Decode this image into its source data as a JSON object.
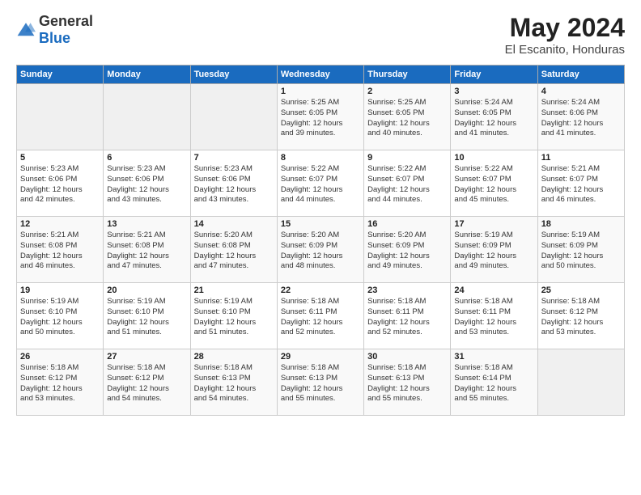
{
  "header": {
    "logo_general": "General",
    "logo_blue": "Blue",
    "month_year": "May 2024",
    "location": "El Escanito, Honduras"
  },
  "days_of_week": [
    "Sunday",
    "Monday",
    "Tuesday",
    "Wednesday",
    "Thursday",
    "Friday",
    "Saturday"
  ],
  "weeks": [
    [
      {
        "day": "",
        "info": ""
      },
      {
        "day": "",
        "info": ""
      },
      {
        "day": "",
        "info": ""
      },
      {
        "day": "1",
        "info": "Sunrise: 5:25 AM\nSunset: 6:05 PM\nDaylight: 12 hours\nand 39 minutes."
      },
      {
        "day": "2",
        "info": "Sunrise: 5:25 AM\nSunset: 6:05 PM\nDaylight: 12 hours\nand 40 minutes."
      },
      {
        "day": "3",
        "info": "Sunrise: 5:24 AM\nSunset: 6:05 PM\nDaylight: 12 hours\nand 41 minutes."
      },
      {
        "day": "4",
        "info": "Sunrise: 5:24 AM\nSunset: 6:06 PM\nDaylight: 12 hours\nand 41 minutes."
      }
    ],
    [
      {
        "day": "5",
        "info": "Sunrise: 5:23 AM\nSunset: 6:06 PM\nDaylight: 12 hours\nand 42 minutes."
      },
      {
        "day": "6",
        "info": "Sunrise: 5:23 AM\nSunset: 6:06 PM\nDaylight: 12 hours\nand 43 minutes."
      },
      {
        "day": "7",
        "info": "Sunrise: 5:23 AM\nSunset: 6:06 PM\nDaylight: 12 hours\nand 43 minutes."
      },
      {
        "day": "8",
        "info": "Sunrise: 5:22 AM\nSunset: 6:07 PM\nDaylight: 12 hours\nand 44 minutes."
      },
      {
        "day": "9",
        "info": "Sunrise: 5:22 AM\nSunset: 6:07 PM\nDaylight: 12 hours\nand 44 minutes."
      },
      {
        "day": "10",
        "info": "Sunrise: 5:22 AM\nSunset: 6:07 PM\nDaylight: 12 hours\nand 45 minutes."
      },
      {
        "day": "11",
        "info": "Sunrise: 5:21 AM\nSunset: 6:07 PM\nDaylight: 12 hours\nand 46 minutes."
      }
    ],
    [
      {
        "day": "12",
        "info": "Sunrise: 5:21 AM\nSunset: 6:08 PM\nDaylight: 12 hours\nand 46 minutes."
      },
      {
        "day": "13",
        "info": "Sunrise: 5:21 AM\nSunset: 6:08 PM\nDaylight: 12 hours\nand 47 minutes."
      },
      {
        "day": "14",
        "info": "Sunrise: 5:20 AM\nSunset: 6:08 PM\nDaylight: 12 hours\nand 47 minutes."
      },
      {
        "day": "15",
        "info": "Sunrise: 5:20 AM\nSunset: 6:09 PM\nDaylight: 12 hours\nand 48 minutes."
      },
      {
        "day": "16",
        "info": "Sunrise: 5:20 AM\nSunset: 6:09 PM\nDaylight: 12 hours\nand 49 minutes."
      },
      {
        "day": "17",
        "info": "Sunrise: 5:19 AM\nSunset: 6:09 PM\nDaylight: 12 hours\nand 49 minutes."
      },
      {
        "day": "18",
        "info": "Sunrise: 5:19 AM\nSunset: 6:09 PM\nDaylight: 12 hours\nand 50 minutes."
      }
    ],
    [
      {
        "day": "19",
        "info": "Sunrise: 5:19 AM\nSunset: 6:10 PM\nDaylight: 12 hours\nand 50 minutes."
      },
      {
        "day": "20",
        "info": "Sunrise: 5:19 AM\nSunset: 6:10 PM\nDaylight: 12 hours\nand 51 minutes."
      },
      {
        "day": "21",
        "info": "Sunrise: 5:19 AM\nSunset: 6:10 PM\nDaylight: 12 hours\nand 51 minutes."
      },
      {
        "day": "22",
        "info": "Sunrise: 5:18 AM\nSunset: 6:11 PM\nDaylight: 12 hours\nand 52 minutes."
      },
      {
        "day": "23",
        "info": "Sunrise: 5:18 AM\nSunset: 6:11 PM\nDaylight: 12 hours\nand 52 minutes."
      },
      {
        "day": "24",
        "info": "Sunrise: 5:18 AM\nSunset: 6:11 PM\nDaylight: 12 hours\nand 53 minutes."
      },
      {
        "day": "25",
        "info": "Sunrise: 5:18 AM\nSunset: 6:12 PM\nDaylight: 12 hours\nand 53 minutes."
      }
    ],
    [
      {
        "day": "26",
        "info": "Sunrise: 5:18 AM\nSunset: 6:12 PM\nDaylight: 12 hours\nand 53 minutes."
      },
      {
        "day": "27",
        "info": "Sunrise: 5:18 AM\nSunset: 6:12 PM\nDaylight: 12 hours\nand 54 minutes."
      },
      {
        "day": "28",
        "info": "Sunrise: 5:18 AM\nSunset: 6:13 PM\nDaylight: 12 hours\nand 54 minutes."
      },
      {
        "day": "29",
        "info": "Sunrise: 5:18 AM\nSunset: 6:13 PM\nDaylight: 12 hours\nand 55 minutes."
      },
      {
        "day": "30",
        "info": "Sunrise: 5:18 AM\nSunset: 6:13 PM\nDaylight: 12 hours\nand 55 minutes."
      },
      {
        "day": "31",
        "info": "Sunrise: 5:18 AM\nSunset: 6:14 PM\nDaylight: 12 hours\nand 55 minutes."
      },
      {
        "day": "",
        "info": ""
      }
    ]
  ]
}
